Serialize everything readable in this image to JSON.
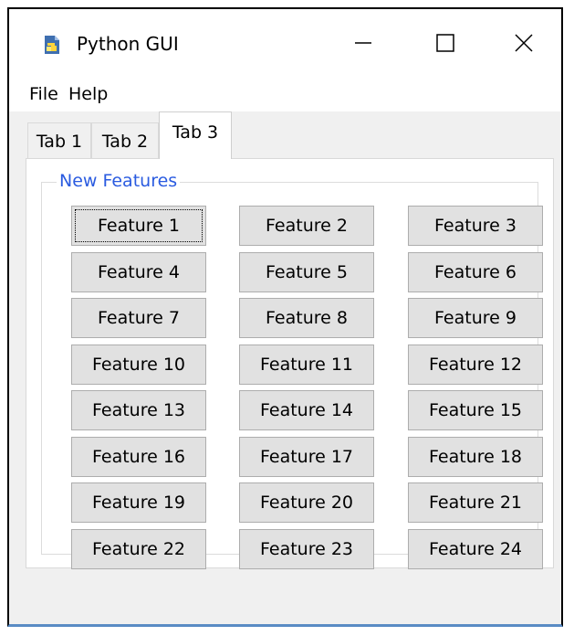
{
  "window": {
    "title": "Python GUI",
    "controls": {
      "minimize": "minimize",
      "maximize": "maximize",
      "close": "close"
    }
  },
  "menu": {
    "items": [
      "File",
      "Help"
    ]
  },
  "tabs": [
    {
      "label": "Tab 1",
      "selected": false
    },
    {
      "label": "Tab 2",
      "selected": false
    },
    {
      "label": "Tab 3",
      "selected": true
    }
  ],
  "group": {
    "label": "New Features",
    "label_color": "#2a5be0",
    "buttons": [
      "Feature 1",
      "Feature 2",
      "Feature 3",
      "Feature 4",
      "Feature 5",
      "Feature 6",
      "Feature 7",
      "Feature 8",
      "Feature 9",
      "Feature 10",
      "Feature 11",
      "Feature 12",
      "Feature 13",
      "Feature 14",
      "Feature 15",
      "Feature 16",
      "Feature 17",
      "Feature 18",
      "Feature 19",
      "Feature 20",
      "Feature 21",
      "Feature 22",
      "Feature 23",
      "Feature 24"
    ],
    "focused_button": "Feature 1"
  }
}
